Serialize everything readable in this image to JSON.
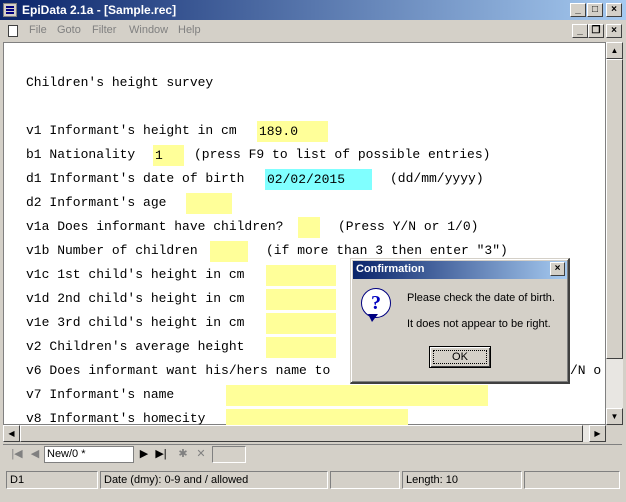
{
  "window": {
    "title": "EpiData 2.1a - [Sample.rec]",
    "min_glyph": "_",
    "max_glyph": "□",
    "close_glyph": "×",
    "restore_glyph": "❐"
  },
  "menu": [
    "File",
    "Goto",
    "Filter",
    "Window",
    "Help"
  ],
  "form": {
    "title": "Children's height survey",
    "rows": [
      {
        "label": "v1  Informant's height in cm",
        "value": "189.0",
        "hint": ""
      },
      {
        "label": "b1  Nationality",
        "value": "1",
        "hint": "(press F9 to list of possible entries)"
      },
      {
        "label": "d1  Informant's date of birth",
        "value": "02/02/2015",
        "hint": "(dd/mm/yyyy)"
      },
      {
        "label": "d2  Informant's age",
        "value": "",
        "hint": ""
      },
      {
        "label": "v1a Does informant have children?",
        "value": "",
        "hint": "(Press Y/N  or 1/0)"
      },
      {
        "label": "v1b Number of children",
        "value": "",
        "hint": "(if more than 3 then enter \"3\")"
      },
      {
        "label": "v1c 1st child's height in cm",
        "value": "",
        "hint": ""
      },
      {
        "label": "v1d 2nd child's height in cm",
        "value": "",
        "hint": ""
      },
      {
        "label": "v1e 3rd child's height in cm",
        "value": "",
        "hint": ""
      },
      {
        "label": "v2  Children's average height",
        "value": "",
        "hint": ""
      },
      {
        "label": "v6  Does informant want his/hers name to",
        "value": "",
        "hint": "/N  o"
      },
      {
        "label": "v7  Informant's name",
        "value": "",
        "hint": ""
      },
      {
        "label": "v8  Informant's homecity",
        "value": "",
        "hint": ""
      }
    ]
  },
  "navigator": {
    "first": "|◀",
    "prev": "◀",
    "record": "New/0 *",
    "next": "▶",
    "last": "▶|",
    "new": "✱",
    "delete": "✕"
  },
  "status": {
    "field": "D1",
    "info": "Date (dmy): 0-9 and / allowed",
    "length": "Length: 10"
  },
  "dialog": {
    "title": "Confirmation",
    "icon": "?",
    "message1": "Please check the date of birth.",
    "message2": "It does not appear to be right.",
    "ok": "OK",
    "close": "×"
  },
  "scroll": {
    "up": "▲",
    "down": "▼",
    "left": "◀",
    "right": "▶"
  },
  "colors": {
    "field": "#ffff99",
    "active_field": "#80ffff",
    "titlebar": "#0a246a"
  }
}
